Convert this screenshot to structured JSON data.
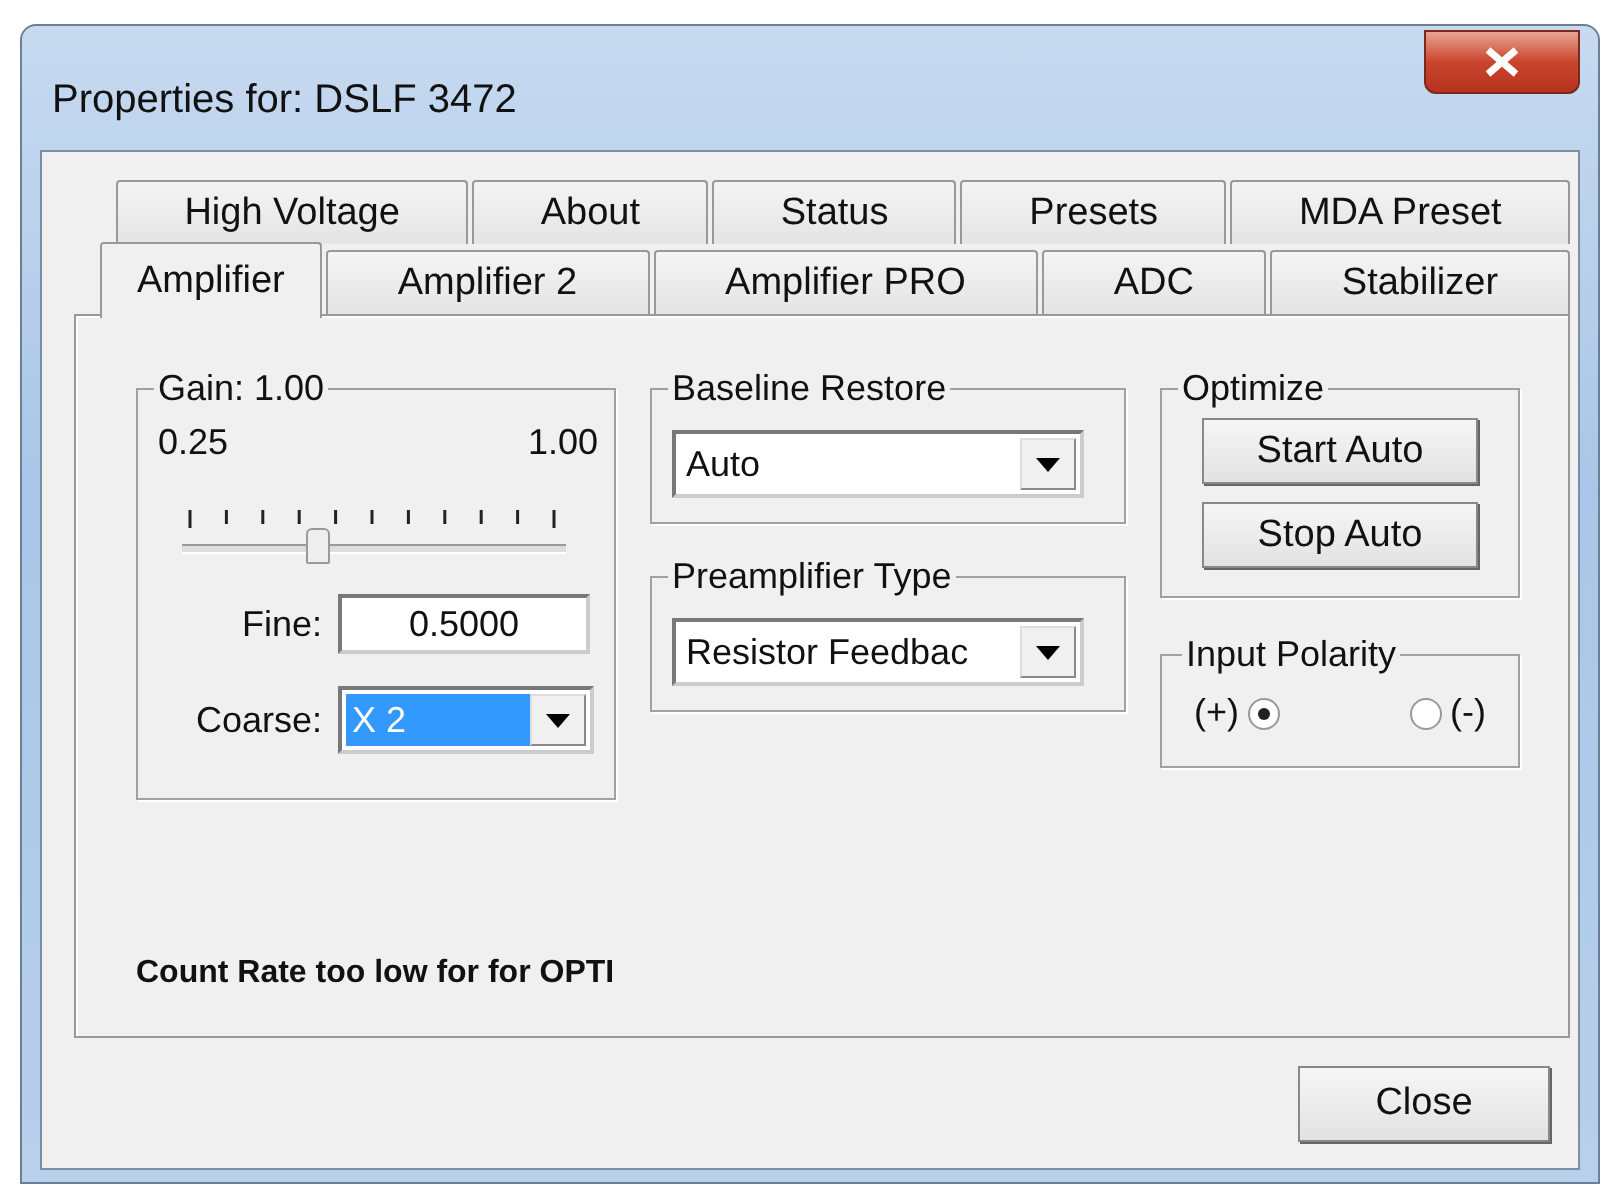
{
  "window": {
    "title": "Properties for: DSLF 3472"
  },
  "tab_rows": [
    {
      "tabs": [
        {
          "label": "High Voltage",
          "selected": false
        },
        {
          "label": "About",
          "selected": false
        },
        {
          "label": "Status",
          "selected": false
        },
        {
          "label": "Presets",
          "selected": false
        },
        {
          "label": "MDA Preset",
          "selected": false
        }
      ]
    },
    {
      "tabs": [
        {
          "label": "Amplifier",
          "selected": true
        },
        {
          "label": "Amplifier 2",
          "selected": false
        },
        {
          "label": "Amplifier PRO",
          "selected": false
        },
        {
          "label": "ADC",
          "selected": false
        },
        {
          "label": "Stabilizer",
          "selected": false
        }
      ]
    }
  ],
  "gain": {
    "title": "Gain: 1.00",
    "min_label": "0.25",
    "max_label": "1.00",
    "slider": {
      "level": 0.35
    },
    "fine_label": "Fine:",
    "fine_value": "0.5000",
    "coarse_label": "Coarse:",
    "coarse_value": "X 2",
    "coarse_highlighted": true
  },
  "baseline_restore": {
    "title": "Baseline Restore",
    "value": "Auto"
  },
  "preamplifier_type": {
    "title": "Preamplifier Type",
    "value": "Resistor Feedbac"
  },
  "optimize": {
    "title": "Optimize",
    "buttons": [
      "Start Auto",
      "Stop Auto"
    ]
  },
  "input_polarity": {
    "title": "Input Polarity",
    "options": [
      {
        "label": "(+)",
        "selected": true,
        "kind": "label-left"
      },
      {
        "label": "(-)",
        "selected": false,
        "kind": "label-right"
      }
    ]
  },
  "status_message": "Count Rate too low for for OPTI",
  "buttons": [
    {
      "label": "Close"
    }
  ]
}
